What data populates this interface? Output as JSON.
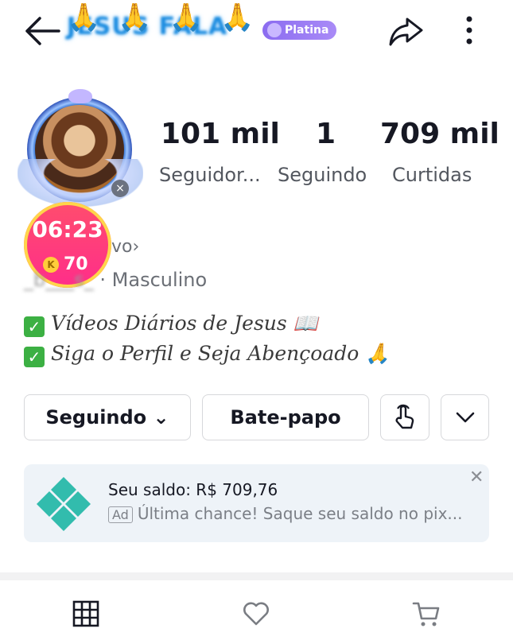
{
  "header": {
    "title": "JESUS FALA",
    "title_emoji": "🙏🙏🙏🙏",
    "badge": "Platina"
  },
  "timer": {
    "time": "06:23",
    "coins": "70",
    "coin_glyph": "K"
  },
  "stats": [
    {
      "value": "101 mil",
      "label": "Seguidor..."
    },
    {
      "value": "1",
      "label": "Seguindo"
    },
    {
      "value": "709 mil",
      "label": "Curtidas"
    }
  ],
  "profile": {
    "status": "vo›",
    "handle": "_b___s_",
    "gender": "· Masculino"
  },
  "bio": [
    "Vídeos Diários de Jesus 📖",
    "Siga o Perfil e Seja Abençoado 🙏"
  ],
  "actions": {
    "following": "Seguindo ⌄",
    "chat": "Bate-papo"
  },
  "ad": {
    "title": "Seu saldo: R$ 709,76",
    "tag": "Ad",
    "text": "Última chance! Saque seu saldo no pix..."
  },
  "icons": [
    "back-arrow",
    "share",
    "more-vertical",
    "poke-hand",
    "chevron-down",
    "grid",
    "heart",
    "cart"
  ],
  "colors": {
    "accent": "#8b6cf0",
    "timer": "#ff2d6d",
    "check": "#3cb043",
    "pix": "#32bcad"
  }
}
